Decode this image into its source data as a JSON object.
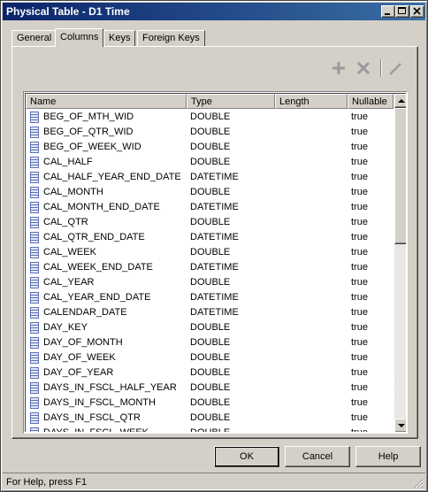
{
  "window": {
    "title": "Physical Table - D1 Time"
  },
  "tabs": [
    {
      "label": "General"
    },
    {
      "label": "Columns"
    },
    {
      "label": "Keys"
    },
    {
      "label": "Foreign Keys"
    }
  ],
  "active_tab": "Columns",
  "toolbar": {
    "add_icon": "plus-icon",
    "delete_icon": "x-icon",
    "edit_icon": "pencil-icon"
  },
  "grid": {
    "headers": {
      "name": "Name",
      "type": "Type",
      "length": "Length",
      "nullable": "Nullable"
    },
    "rows": [
      {
        "name": "BEG_OF_MTH_WID",
        "type": "DOUBLE",
        "length": "",
        "nullable": "true"
      },
      {
        "name": "BEG_OF_QTR_WID",
        "type": "DOUBLE",
        "length": "",
        "nullable": "true"
      },
      {
        "name": "BEG_OF_WEEK_WID",
        "type": "DOUBLE",
        "length": "",
        "nullable": "true"
      },
      {
        "name": "CAL_HALF",
        "type": "DOUBLE",
        "length": "",
        "nullable": "true"
      },
      {
        "name": "CAL_HALF_YEAR_END_DATE",
        "type": "DATETIME",
        "length": "",
        "nullable": "true"
      },
      {
        "name": "CAL_MONTH",
        "type": "DOUBLE",
        "length": "",
        "nullable": "true"
      },
      {
        "name": "CAL_MONTH_END_DATE",
        "type": "DATETIME",
        "length": "",
        "nullable": "true"
      },
      {
        "name": "CAL_QTR",
        "type": "DOUBLE",
        "length": "",
        "nullable": "true"
      },
      {
        "name": "CAL_QTR_END_DATE",
        "type": "DATETIME",
        "length": "",
        "nullable": "true"
      },
      {
        "name": "CAL_WEEK",
        "type": "DOUBLE",
        "length": "",
        "nullable": "true"
      },
      {
        "name": "CAL_WEEK_END_DATE",
        "type": "DATETIME",
        "length": "",
        "nullable": "true"
      },
      {
        "name": "CAL_YEAR",
        "type": "DOUBLE",
        "length": "",
        "nullable": "true"
      },
      {
        "name": "CAL_YEAR_END_DATE",
        "type": "DATETIME",
        "length": "",
        "nullable": "true"
      },
      {
        "name": "CALENDAR_DATE",
        "type": "DATETIME",
        "length": "",
        "nullable": "true"
      },
      {
        "name": "DAY_KEY",
        "type": "DOUBLE",
        "length": "",
        "nullable": "true"
      },
      {
        "name": "DAY_OF_MONTH",
        "type": "DOUBLE",
        "length": "",
        "nullable": "true"
      },
      {
        "name": "DAY_OF_WEEK",
        "type": "DOUBLE",
        "length": "",
        "nullable": "true"
      },
      {
        "name": "DAY_OF_YEAR",
        "type": "DOUBLE",
        "length": "",
        "nullable": "true"
      },
      {
        "name": "DAYS_IN_FSCL_HALF_YEAR",
        "type": "DOUBLE",
        "length": "",
        "nullable": "true"
      },
      {
        "name": "DAYS_IN_FSCL_MONTH",
        "type": "DOUBLE",
        "length": "",
        "nullable": "true"
      },
      {
        "name": "DAYS_IN_FSCL_QTR",
        "type": "DOUBLE",
        "length": "",
        "nullable": "true"
      },
      {
        "name": "DAYS_IN_FSCL_WEEK",
        "type": "DOUBLE",
        "length": "",
        "nullable": "true"
      }
    ]
  },
  "buttons": {
    "ok": "OK",
    "cancel": "Cancel",
    "help": "Help"
  },
  "status": {
    "text": "For Help, press F1"
  },
  "colors": {
    "titlebar_start": "#0a246a",
    "titlebar_end": "#3a6ea5",
    "face": "#d4d0c8",
    "column_icon": "#5a6fb8"
  }
}
